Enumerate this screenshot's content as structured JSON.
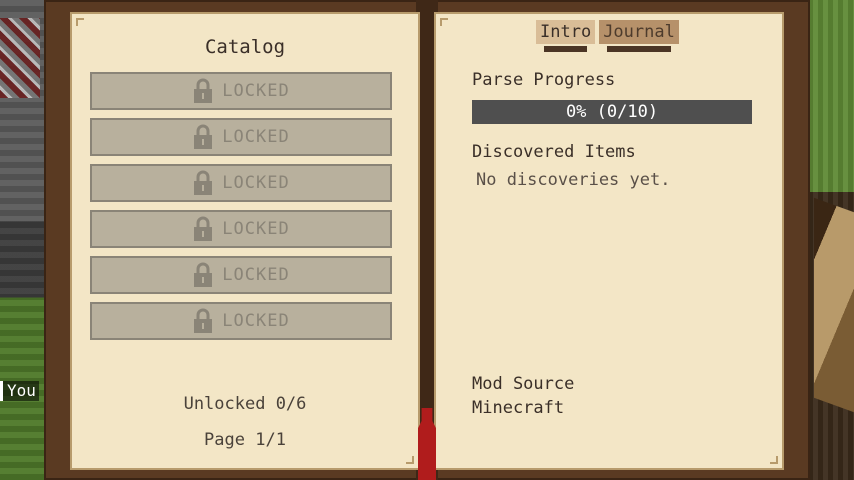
{
  "chat": {
    "text": "You"
  },
  "catalog": {
    "title": "Catalog",
    "slots": [
      {
        "label": "LOCKED"
      },
      {
        "label": "LOCKED"
      },
      {
        "label": "LOCKED"
      },
      {
        "label": "LOCKED"
      },
      {
        "label": "LOCKED"
      },
      {
        "label": "LOCKED"
      }
    ],
    "unlocked": "Unlocked 0/6",
    "page": "Page 1/1"
  },
  "journal": {
    "tabs": [
      {
        "label": "Intro",
        "active": true
      },
      {
        "label": "Journal",
        "active": false
      }
    ],
    "parse_progress_label": "Parse Progress",
    "parse_progress_text": "0% (0/10)",
    "parse_progress_fraction": 0,
    "discovered_label": "Discovered Items",
    "discovered_empty": "No discoveries yet.",
    "mod_source_label": "Mod Source",
    "mod_source_value": "Minecraft"
  },
  "colors": {
    "page": "#f3e6c6",
    "book_frame": "#5a3a22",
    "slot_locked": "#b8b09d",
    "progress_bg": "#4f4f4f",
    "ribbon": "#b01c1c"
  }
}
